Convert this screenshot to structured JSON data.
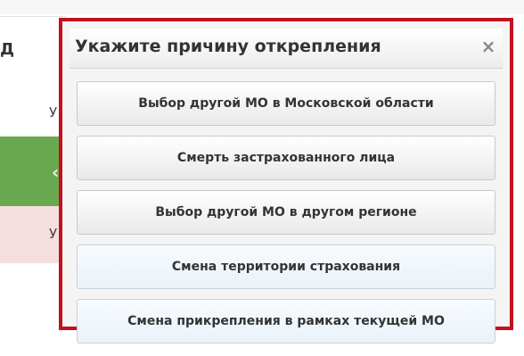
{
  "background": {
    "column_header": "Д",
    "rows": [
      {
        "text": "У"
      },
      {
        "chevron": "‹"
      },
      {
        "text": "У"
      }
    ]
  },
  "dialog": {
    "title": "Укажите причину открепления",
    "close_glyph": "×",
    "border_color": "#c0121f",
    "buttons": [
      {
        "label": "Выбор другой МО в Московской области"
      },
      {
        "label": "Смерть застрахованного лица"
      },
      {
        "label": "Выбор другой МО в другом регионе"
      },
      {
        "label": "Смена территории страхования"
      },
      {
        "label": "Смена прикрепления в рамках текущей МО"
      }
    ]
  }
}
